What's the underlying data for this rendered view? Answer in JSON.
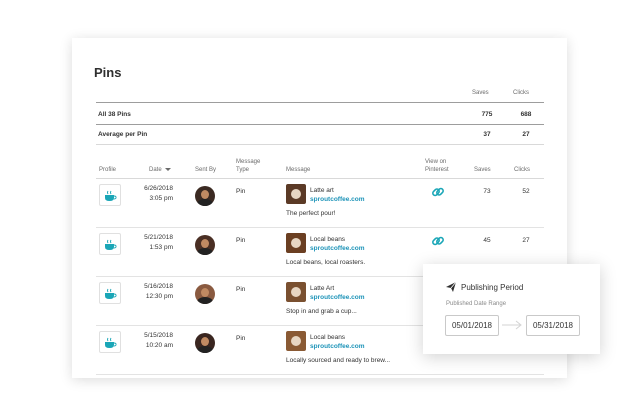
{
  "page": {
    "title": "Pins"
  },
  "summary": {
    "saves_label": "Saves",
    "clicks_label": "Clicks",
    "rows": [
      {
        "label": "All 38 Pins",
        "saves": "775",
        "clicks": "688"
      },
      {
        "label": "Average per Pin",
        "saves": "37",
        "clicks": "27"
      }
    ]
  },
  "table": {
    "columns": {
      "profile": "Profile",
      "date": "Date",
      "sent_by": "Sent By",
      "message_type": [
        "Message",
        "Type"
      ],
      "message": "Message",
      "view": [
        "View on",
        "Pinterest"
      ],
      "saves": "Saves",
      "clicks": "Clicks"
    },
    "rows": [
      {
        "date": "6/26/2018",
        "time": "3:05 pm",
        "type": "Pin",
        "title": "Latte art",
        "link": "sproutcoffee.com",
        "body": "The perfect pour!",
        "saves": "73",
        "clicks": "52",
        "avatar_color": "#3b2a22",
        "thumb_color": "#5b3a26"
      },
      {
        "date": "5/21/2018",
        "time": "1:53 pm",
        "type": "Pin",
        "title": "Local beans",
        "link": "sproutcoffee.com",
        "body": "Local beans, local roasters.",
        "saves": "45",
        "clicks": "27",
        "avatar_color": "#4a2f24",
        "thumb_color": "#6b3f22"
      },
      {
        "date": "5/16/2018",
        "time": "12:30 pm",
        "type": "Pin",
        "title": "Latte Art",
        "link": "sproutcoffee.com",
        "body": "Stop in and grab a cup...",
        "saves": "",
        "clicks": "",
        "avatar_color": "#8a5a40",
        "thumb_color": "#7a5030"
      },
      {
        "date": "5/15/2018",
        "time": "10:20 am",
        "type": "Pin",
        "title": "Local beans",
        "link": "sproutcoffee.com",
        "body": "Locally sourced and ready to brew...",
        "saves": "",
        "clicks": "",
        "avatar_color": "#3a2620",
        "thumb_color": "#8a5a34"
      }
    ]
  },
  "popup": {
    "title": "Publishing Period",
    "label": "Published Date Range",
    "start": "05/01/2018",
    "end": "05/31/2018"
  },
  "colors": {
    "link": "#1c93b8",
    "profile_icon": "#1aa6b7"
  },
  "icons": {
    "profile": "coffee-cup-icon",
    "view": "link-chain-icon",
    "sort": "caret-down-icon",
    "popup": "paper-plane-icon"
  }
}
